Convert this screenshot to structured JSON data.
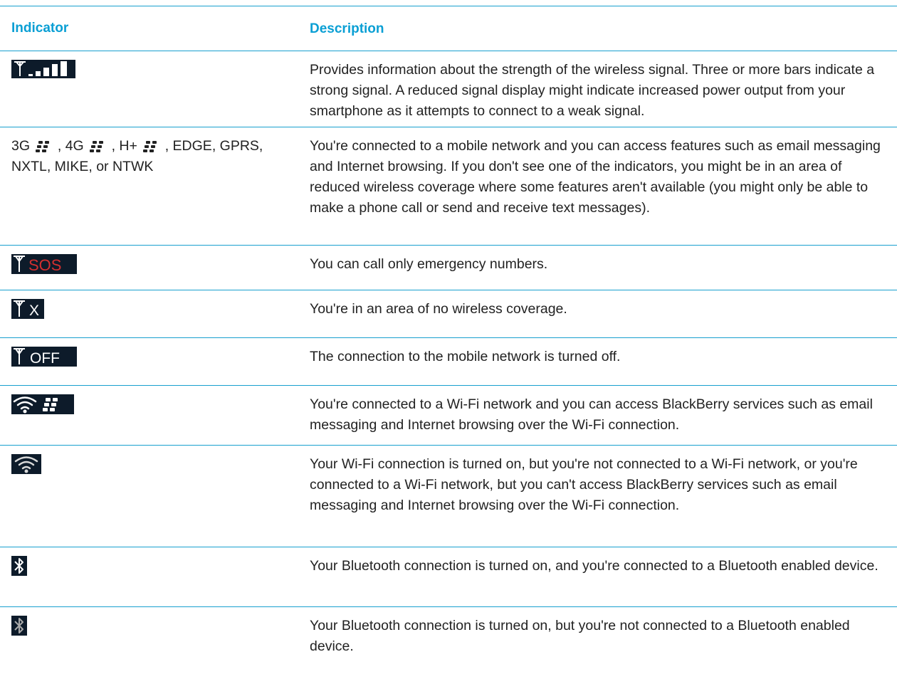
{
  "table": {
    "header": {
      "indicator": "Indicator",
      "description": "Description"
    },
    "rows": [
      {
        "icon": "signal-strength-icon",
        "description": "Provides information about the strength of the wireless signal. Three or more bars indicate a strong signal. A reduced signal display might indicate increased power output from your smartphone as it attempts to connect to a weak signal."
      },
      {
        "indicator_parts": [
          "3G",
          ", 4G",
          ", H+",
          ", EDGE, GPRS, NXTL, MIKE, or NTWK"
        ],
        "icon": "blackberry-logo-icon",
        "description": "You're connected to a mobile network and you can access features such as email messaging and Internet browsing. If you don't see one of the indicators, you might be in an area of reduced wireless coverage where some features aren't available (you might only be able to make a phone call or send and receive text messages)."
      },
      {
        "icon": "signal-sos-icon",
        "icon_text": "SOS",
        "description": "You can call only emergency numbers."
      },
      {
        "icon": "signal-no-coverage-icon",
        "icon_text": "X",
        "description": "You're in an area of no wireless coverage."
      },
      {
        "icon": "signal-off-icon",
        "icon_text": "OFF",
        "description": "The connection to the mobile network is turned off."
      },
      {
        "icon": "wifi-blackberry-icon",
        "description": "You're connected to a Wi-Fi network and you can access BlackBerry services such as email messaging and Internet browsing over the Wi-Fi connection."
      },
      {
        "icon": "wifi-icon",
        "description": "Your Wi-Fi connection is turned on, but you're not connected to a Wi-Fi network, or you're connected to a Wi-Fi network, but you can't access BlackBerry services such as email messaging and Internet browsing over the Wi-Fi connection."
      },
      {
        "icon": "bluetooth-connected-icon",
        "description": "Your Bluetooth connection is turned on, and you're connected to a Bluetooth enabled device."
      },
      {
        "icon": "bluetooth-on-icon",
        "description": "Your Bluetooth connection is turned on, but you're not connected to a Bluetooth enabled device."
      }
    ]
  },
  "colors": {
    "accent": "#0a9fd4",
    "rule": "#18a0cf",
    "icon_bg": "#0d1b2a",
    "sos_red": "#d32f2f"
  }
}
